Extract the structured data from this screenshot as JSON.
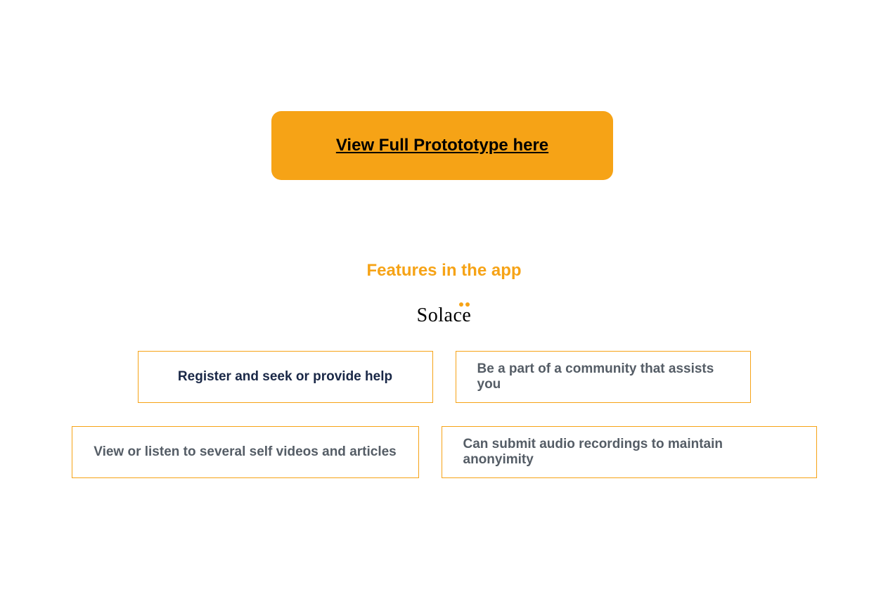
{
  "prototype_button": {
    "label": "View Full Protototype here"
  },
  "features_heading": "Features  in  the app",
  "logo": {
    "text": "Solace"
  },
  "features": {
    "card1": "Register and seek or provide help",
    "card2": "Be a part of a community that assists you",
    "card3": "View or listen to several self videos and articles",
    "card4": "Can submit audio recordings to maintain anonyimity"
  },
  "colors": {
    "accent": "#f6a316",
    "dark_text": "#1a2847",
    "gray_text": "#555d66"
  }
}
